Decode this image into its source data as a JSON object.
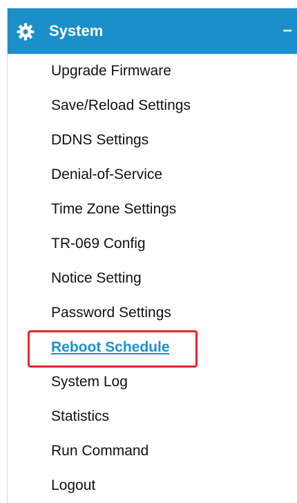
{
  "section": {
    "title": "System",
    "collapse_symbol": "–",
    "icon": "gear-icon",
    "header_color": "#1a8fc9"
  },
  "menu": {
    "items": [
      {
        "label": "Upgrade Firmware"
      },
      {
        "label": "Save/Reload Settings"
      },
      {
        "label": "DDNS Settings"
      },
      {
        "label": "Denial-of-Service"
      },
      {
        "label": "Time Zone Settings"
      },
      {
        "label": "TR-069 Config"
      },
      {
        "label": "Notice Setting"
      },
      {
        "label": "Password Settings"
      },
      {
        "label": "Reboot Schedule",
        "active": true
      },
      {
        "label": "System Log"
      },
      {
        "label": "Statistics"
      },
      {
        "label": "Run Command"
      },
      {
        "label": "Logout"
      }
    ]
  },
  "colors": {
    "active_link": "#1f8fcf",
    "highlight_border": "#e8232a"
  }
}
